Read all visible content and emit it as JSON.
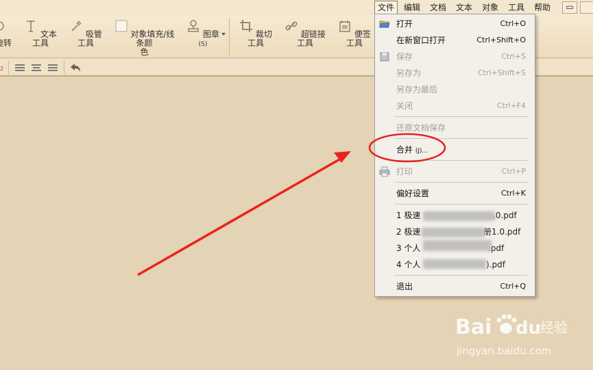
{
  "menubar": {
    "items": [
      "文件",
      "编辑",
      "文档",
      "文本",
      "对象",
      "工具",
      "帮助"
    ],
    "active_index": 0,
    "minimize_glyph": "▭"
  },
  "toolbar": {
    "tools": [
      "旋转",
      "文本工具",
      "吸管工具",
      "对象填充/线条颜色",
      "图章(S)",
      "裁切工具",
      "超链接工具",
      "便签工具"
    ],
    "fill_tool_label_line1": "对象填充/线条颜",
    "fill_tool_label_line2": "色",
    "stamp_label": "图章",
    "stamp_suffix": "(S)"
  },
  "file_menu": {
    "open": {
      "label": "打开",
      "shortcut": "Ctrl+O"
    },
    "open_new_window": {
      "label": "在新窗口打开",
      "shortcut": "Ctrl+Shift+O"
    },
    "save": {
      "label": "保存",
      "shortcut": "Ctrl+S"
    },
    "save_as": {
      "label": "另存为",
      "shortcut": "Ctrl+Shift+S"
    },
    "save_as_final": {
      "label": "另存为最后"
    },
    "close": {
      "label": "关闭",
      "shortcut": "Ctrl+F4"
    },
    "restore_save": {
      "label": "还原文档保存"
    },
    "merge": {
      "label": "合并",
      "suffix": "(J)..."
    },
    "print": {
      "label": "打印",
      "shortcut": "Ctrl+P"
    },
    "preferences": {
      "label": "偏好设置",
      "shortcut": "Ctrl+K"
    },
    "recent": [
      {
        "prefix": "1 极速",
        "suffix": ".0.pdf"
      },
      {
        "prefix": "2 极速",
        "suffix": "册1.0.pdf"
      },
      {
        "prefix": "3 个人",
        "suffix": ".pdf"
      },
      {
        "prefix": "4 个人",
        "suffix": ").pdf"
      }
    ],
    "exit": {
      "label": "退出",
      "shortcut": "Ctrl+Q"
    }
  },
  "watermark": {
    "brand_left": "Bai",
    "brand_right": "du",
    "brand_cn": "经验",
    "url": "jingyan.baidu.com"
  },
  "colors": {
    "annotation_red": "#e8231e",
    "background": "#e3d2b4"
  }
}
